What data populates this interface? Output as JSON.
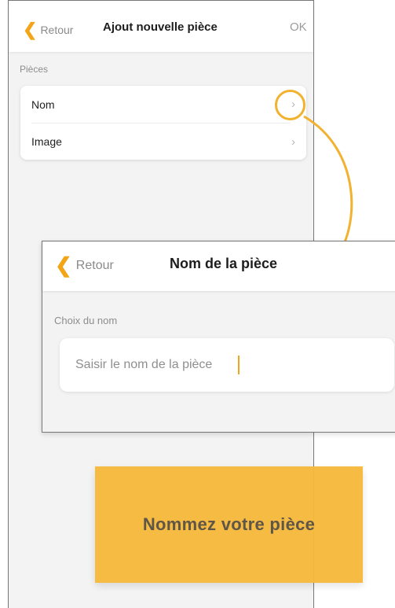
{
  "back_screen": {
    "nav": {
      "back_label": "Retour",
      "title": "Ajout nouvelle pièce",
      "ok_label": "OK"
    },
    "section_label": "Pièces",
    "rows": [
      {
        "label": "Nom",
        "chevron": "›"
      },
      {
        "label": "Image",
        "chevron": "›"
      }
    ]
  },
  "front_screen": {
    "nav": {
      "back_label": "Retour",
      "title": "Nom de la pièce"
    },
    "section_label": "Choix du nom",
    "input": {
      "placeholder": "Saisir le nom de la pièce",
      "value": ""
    }
  },
  "callout": {
    "text": "Nommez votre pièce"
  },
  "colors": {
    "accent": "#f2a516",
    "callout_bg": "#f6b93b",
    "callout_text": "#5a5041"
  },
  "icons": {
    "back": "chevron-left-icon",
    "row": "chevron-right-icon"
  }
}
